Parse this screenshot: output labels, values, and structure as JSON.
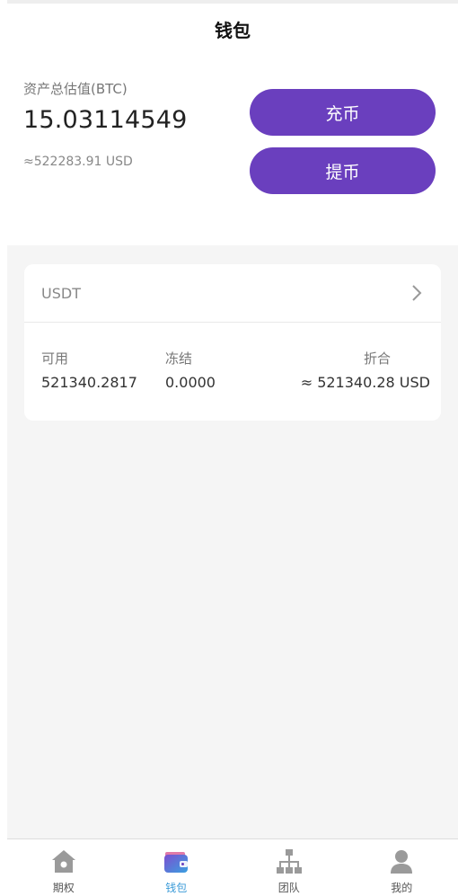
{
  "header": {
    "title": "钱包"
  },
  "summary": {
    "label": "资产总估值(BTC)",
    "btc_value": "15.03114549",
    "usd_value": "≈522283.91 USD"
  },
  "actions": {
    "deposit_label": "充币",
    "withdraw_label": "提币"
  },
  "asset_card": {
    "coin": "USDT",
    "available_label": "可用",
    "available_value": "521340.2817",
    "frozen_label": "冻结",
    "frozen_value": "0.0000",
    "converted_label": "折合",
    "converted_value": "≈ 521340.28 USD"
  },
  "tabbar": {
    "items": [
      {
        "label": "期权",
        "icon": "home-icon"
      },
      {
        "label": "钱包",
        "icon": "wallet-icon"
      },
      {
        "label": "团队",
        "icon": "team-hierarchy-icon"
      },
      {
        "label": "我的",
        "icon": "user-icon"
      }
    ],
    "active_index": 1
  },
  "colors": {
    "accent": "#6a3fbe",
    "active_tab": "#3b9bd8",
    "inactive_icon": "#9a9a9a",
    "background": "#f5f5f5"
  }
}
